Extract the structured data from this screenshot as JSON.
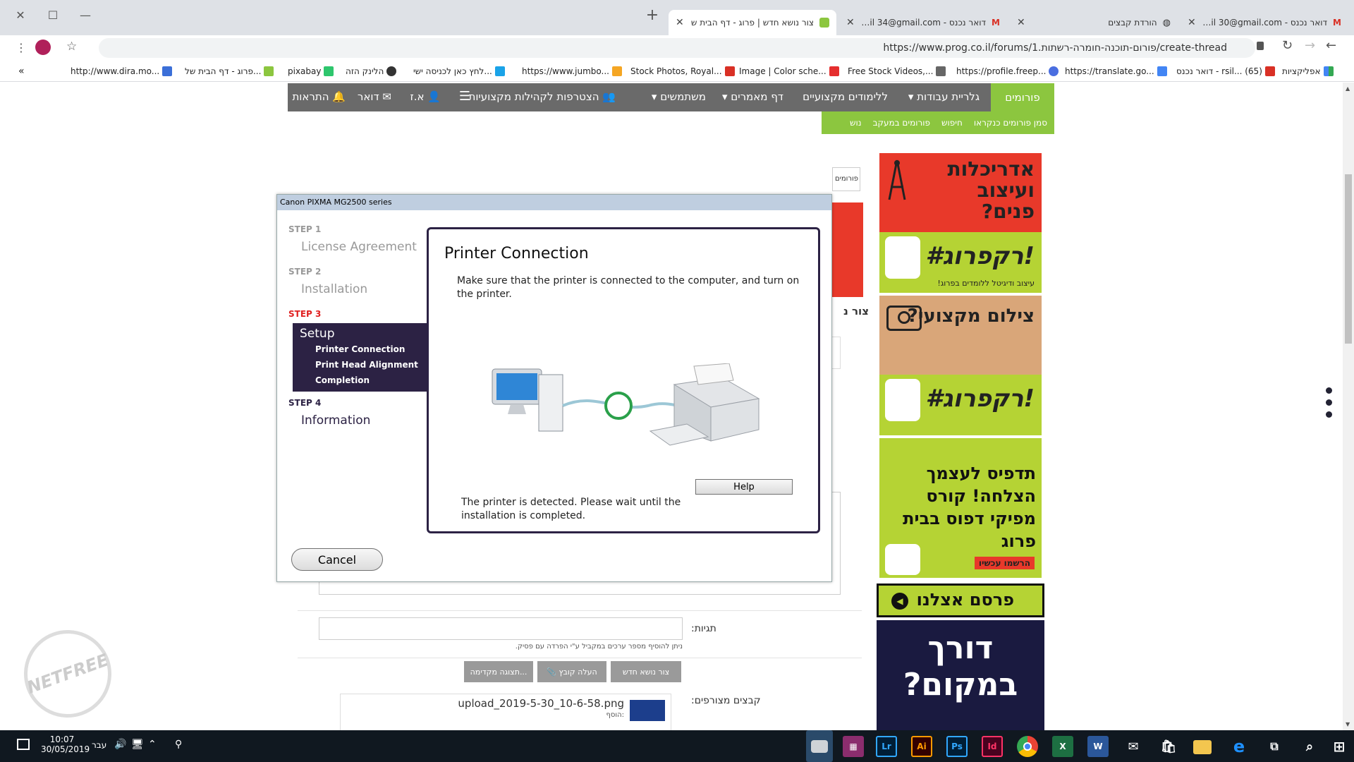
{
  "browser": {
    "tabs": [
      {
        "label": "דואר נכנס - Gmail ‎30@gmail.com",
        "icon": "gmail-icon"
      },
      {
        "label": "הורדת קבצים",
        "icon": "globe-icon"
      },
      {
        "label": "דואר נכנס - Gmail ‎34@gmail.com",
        "icon": "gmail-icon"
      },
      {
        "label": "צור נושא חדש | פרוג - דף הבית ש",
        "icon": "prog-icon"
      }
    ],
    "new_tab": "+",
    "url": "https://www.prog.co.il/forums/1.פורום-תוכנה-חומרה-רשתות/create-thread",
    "bookmarks": [
      {
        "label": "אפליקציות",
        "color": "#4285f4"
      },
      {
        "label": "דואר נכנס - rsil... (65)",
        "color": "#d93025"
      },
      {
        "label": "https://translate.go...",
        "color": "#4285f4"
      },
      {
        "label": "https://profile.freep...",
        "color": "#4a6ee0"
      },
      {
        "label": "Free Stock Videos,...",
        "color": "#666"
      },
      {
        "label": "Image | Color sche...",
        "color": "#e52e2e"
      },
      {
        "label": "Stock Photos, Royal...",
        "color": "#d93025"
      },
      {
        "label": "https://www.jumbo...",
        "color": "#f5a623"
      },
      {
        "label": "לחץ כאן לכניסה ישי...",
        "color": "#1aa3e8"
      },
      {
        "label": "הלינק הזה",
        "color": "#333"
      },
      {
        "label": "pixabay",
        "color": "#2ec66d"
      },
      {
        "label": "פרוג - דף הבית של...",
        "color": "#8cc63f"
      },
      {
        "label": "http://www.dira.mo...",
        "color": "#3b6fd8"
      }
    ]
  },
  "site": {
    "nav": {
      "forums": "פורומים",
      "items": [
        "גלריית עבודות",
        "ללימודים מקצועיים",
        "דף מאמרים",
        "משתמשים",
        "הצטרפות לקהילות מקצועיות"
      ],
      "user": "א.ז",
      "mail": "דואר",
      "alerts": "התראות"
    },
    "subnav": [
      "סמן פורומים כנקראו",
      "חיפוש",
      "פורומים במעקב",
      "נוש"
    ],
    "breadcrumb": "פורומים",
    "create_label": "צור נ",
    "tags_label": "תגיות:",
    "tags_hint": "ניתן להוסיף מספר ערכים במקביל ע\"י הפרדה עם פסיק.",
    "buttons": {
      "create": "צור נושא חדש",
      "upload": "העלה קובץ",
      "preview": "תצוגה מקדימה..."
    },
    "attachments_label": "קבצים מצורפים:",
    "attachment_name": "upload_2019-5-30_10-6-58.png",
    "attachment_meta": "הוסף:",
    "ads": [
      {
        "headline": "אדריכלות ועיצוב פנים?",
        "tag": "#רקפרוג!",
        "sub": "עיצוב ודיגיטל ללומדים בפרוג!",
        "bg": "#f33e2e"
      },
      {
        "headline": "צילום מקצועי?",
        "tag": "#רקפרוג!",
        "sub": "",
        "bg": "#8cc63f"
      },
      {
        "headline": "תדפיס לעצמך הצלחה! קורס מפיקי דפוס בבית פרוג",
        "tag": "הרשמו עכשיו",
        "sub": "",
        "bg": "#b5d334"
      },
      {
        "headline": "פרסם אצלנו",
        "tag": "",
        "sub": "",
        "bg": "#b5d334"
      },
      {
        "headline": "דורך במקום?",
        "tag": "",
        "sub": "",
        "bg": "#1a1a40"
      }
    ],
    "watermark": "NETFREE"
  },
  "installer": {
    "window_title": "Canon PIXMA MG2500 series",
    "steps": [
      {
        "step": "STEP 1",
        "label": "License Agreement"
      },
      {
        "step": "STEP 2",
        "label": "Installation"
      },
      {
        "step": "STEP 3",
        "label": "Setup"
      },
      {
        "step": "STEP 4",
        "label": "Information"
      }
    ],
    "substeps": [
      "Printer Connection",
      "Print Head Alignment",
      "Completion"
    ],
    "dialog_title": "Printer Connection",
    "dialog_instruction": "Make sure that the printer is connected to the computer, and turn on the printer.",
    "status": "The printer is detected. Please wait until the installation is completed.",
    "help": "Help",
    "cancel": "Cancel"
  },
  "taskbar": {
    "time": "10:07",
    "date": "30/05/2019",
    "lang": "עבר",
    "apps": [
      {
        "label": "Lr",
        "color": "#31a8ff",
        "bg": "#001e36"
      },
      {
        "label": "Ai",
        "color": "#ff9a00",
        "bg": "#330000"
      },
      {
        "label": "Ps",
        "color": "#31a8ff",
        "bg": "#001e36"
      },
      {
        "label": "Id",
        "color": "#ff3366",
        "bg": "#49021f"
      },
      {
        "label": "X",
        "color": "#fff",
        "bg": "#1d6f42"
      },
      {
        "label": "W",
        "color": "#fff",
        "bg": "#2b579a"
      }
    ]
  }
}
